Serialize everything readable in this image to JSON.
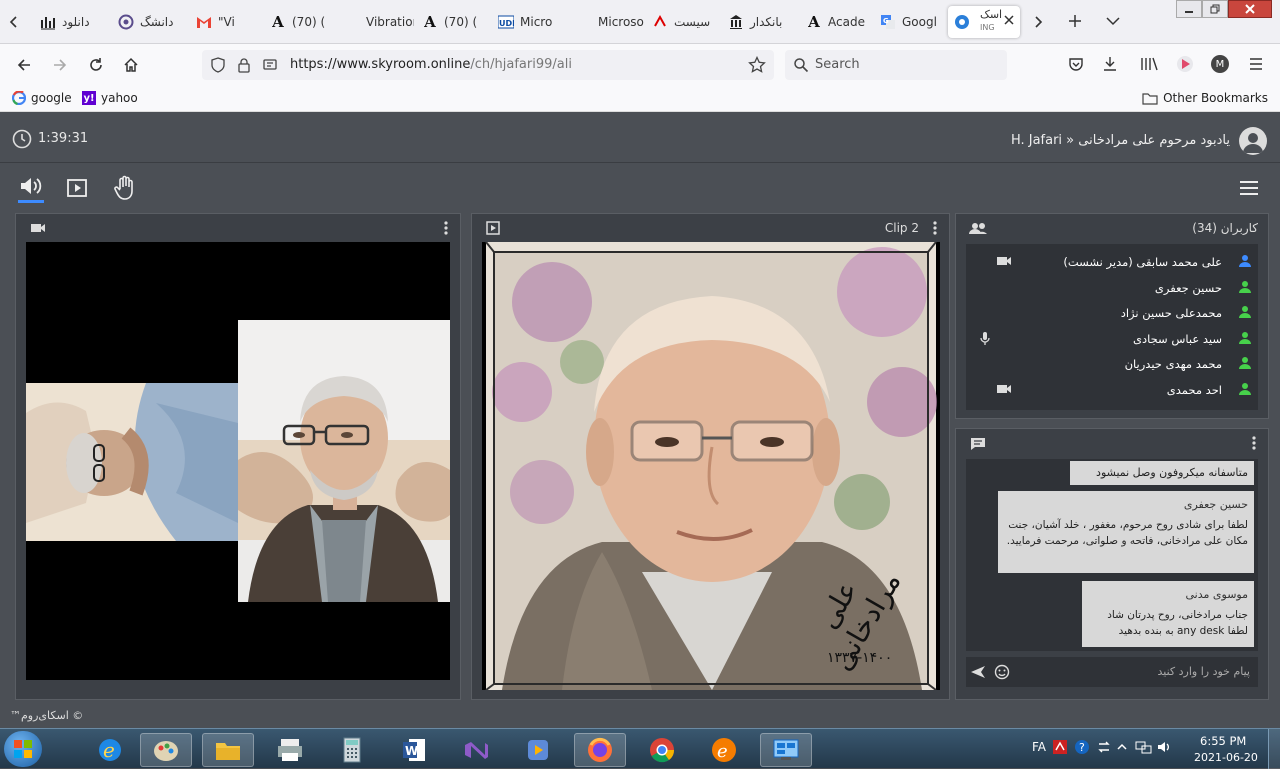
{
  "browser": {
    "tabs": [
      {
        "label": "دانلود",
        "icon": "bar-chart-icon"
      },
      {
        "label": "دانشگ",
        "icon": "university-icon"
      },
      {
        "label": "\"Vi",
        "icon": "gmail-icon"
      },
      {
        "label": "(70) (",
        "icon": "letter-a-icon"
      },
      {
        "label": "Vibration_",
        "icon": "page-icon"
      },
      {
        "label": "(70) (",
        "icon": "letter-a-icon"
      },
      {
        "label": "Micro",
        "icon": "ude-icon"
      },
      {
        "label": "Microsoft",
        "icon": "page-icon"
      },
      {
        "label": "سیست",
        "icon": "tv-icon"
      },
      {
        "label": "بانکدار",
        "icon": "bank-icon"
      },
      {
        "label": "Acade",
        "icon": "letter-a-icon"
      },
      {
        "label": "Googl",
        "icon": "google-translate-icon"
      },
      {
        "label": "اسک",
        "sub": "ING",
        "icon": "skyroom-icon",
        "active": true
      }
    ],
    "url": "https://www.skyroom.online/ch/hjafari99/ali",
    "url_host": "https://www.skyroom.online",
    "url_path": "/ch/hjafari99/ali",
    "search_placeholder": "Search",
    "bookmarks": [
      {
        "label": "google",
        "icon": "google-icon"
      },
      {
        "label": "yahoo",
        "icon": "yahoo-icon"
      }
    ],
    "other_bookmarks": "Other Bookmarks",
    "profile_initial": "M"
  },
  "app": {
    "timer": "1:39:31",
    "room_title": "H. Jafari » یادبود مرحوم علی مرادخانی",
    "clip_title": "Clip 2",
    "users_title": "کاربران (34)",
    "users": [
      {
        "name": "علی محمد سابقی (مدیر نشست)",
        "role": "admin",
        "media": "camera"
      },
      {
        "name": "حسین جعفری",
        "role": "user",
        "media": ""
      },
      {
        "name": "محمدعلی حسین نژاد",
        "role": "user",
        "media": ""
      },
      {
        "name": "سید عباس سجادی",
        "role": "user",
        "media": "mic"
      },
      {
        "name": "محمد مهدی حیدریان",
        "role": "user",
        "media": ""
      },
      {
        "name": "احد محمدی",
        "role": "user",
        "media": "camera"
      }
    ],
    "chat": [
      {
        "author": "",
        "text": "متاسفانه میکروفون وصل نمیشود"
      },
      {
        "author": "حسین جعفری",
        "text": "لطفا برای شادی روح مرحوم، مغفور ، خلد آشیان، جنت مکان علی مرادخانی، فاتحه و صلواتی، مرحمت فرمایید."
      },
      {
        "author": "موسوی مدنی",
        "text": "جناب مرادخانی، روح پدرتان شاد",
        "text2": "لطفا any desk به بنده بدهید"
      }
    ],
    "chat_placeholder": "پیام خود را وارد کنید",
    "footer": "© اسکای‌روم™",
    "photo_caption_name": "علی مرادخانی",
    "photo_caption_years": "۱۳۳۷-۱۴۰۰"
  },
  "taskbar": {
    "lang": "FA",
    "time": "6:55 PM",
    "date": "2021-06-20"
  },
  "colors": {
    "app_bg": "#4b4f55",
    "panel_bg": "#3c4046",
    "accent_blue": "#3d8bff",
    "user_green": "#47d14b"
  }
}
